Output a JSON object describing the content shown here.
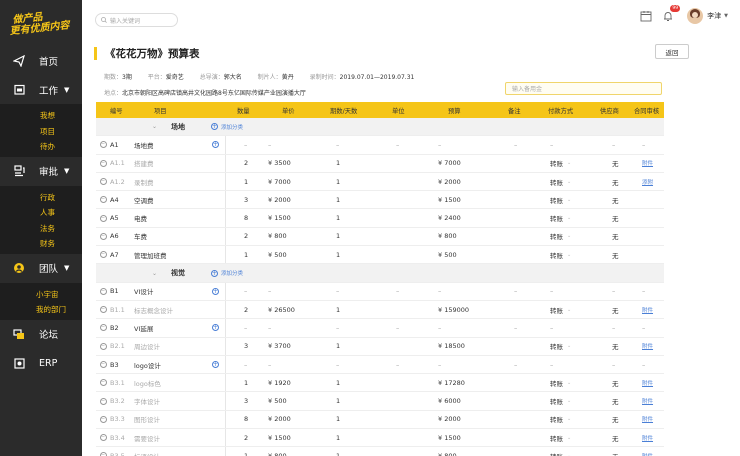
{
  "sidebar": {
    "logo_line1": "做产品",
    "logo_line2": "更有优质内容",
    "nav": {
      "home": "首页",
      "work": "工作",
      "work_sub": [
        "我想",
        "项目",
        "待办"
      ],
      "approval": "审批",
      "approval_sub": [
        "行政",
        "人事",
        "法务",
        "财务"
      ],
      "team": "团队",
      "team_sub": [
        "小宇宙",
        "我的部门"
      ],
      "forum": "论坛",
      "erp": "ERP"
    }
  },
  "topbar": {
    "search_placeholder": "输入关键词",
    "badge_count": "99",
    "user_name": "李津"
  },
  "page": {
    "title": "《花花万物》预算表",
    "return_label": "返回",
    "meta": {
      "episode_label": "期数：",
      "episode_value": "3期",
      "platform_label": "平台：",
      "platform_value": "爱奇艺",
      "director_label": "总导演：",
      "director_value": "郭大名",
      "producer_label": "制片人：",
      "producer_value": "黄丹",
      "period_label": "录制时间：",
      "period_value": "2019.07.01—2019.07.31",
      "location_label": "地点：",
      "location_value": "北京市朝阳区高碑店镇高井文化园路8号东亿国际传媒产业园演播大厅"
    },
    "note_placeholder": "输入备用金"
  },
  "table": {
    "headers": [
      "编号",
      "项目",
      "数量",
      "单价",
      "期数/天数",
      "单位",
      "预算",
      "备注",
      "付款方式",
      "供应商",
      "合同审核"
    ],
    "add_category": "添加分类",
    "groups": [
      {
        "name": "场地",
        "rows": [
          {
            "code": "A1",
            "item": "场地费",
            "qty": "–",
            "price": "–",
            "days": "–",
            "unit": "–",
            "budget": "–",
            "remark": "–",
            "pay": "–",
            "sup": "–",
            "contract": "–",
            "type": "main"
          },
          {
            "code": "A1.1",
            "item": "搭建费",
            "qty": "2",
            "price": "¥  3500",
            "days": "1",
            "unit": "",
            "budget": "¥  7000",
            "remark": "",
            "pay": "转账",
            "sup": "无",
            "contract": "附件",
            "type": "sub"
          },
          {
            "code": "A1.2",
            "item": "录制费",
            "qty": "1",
            "price": "¥  7000",
            "days": "1",
            "unit": "",
            "budget": "¥  2000",
            "remark": "",
            "pay": "转账",
            "sup": "无",
            "contract": "添附",
            "type": "sub"
          },
          {
            "code": "A4",
            "item": "空调费",
            "qty": "3",
            "price": "¥  2000",
            "days": "1",
            "unit": "",
            "budget": "¥  1500",
            "remark": "",
            "pay": "转账",
            "sup": "无",
            "contract": "",
            "type": "main"
          },
          {
            "code": "A5",
            "item": "电费",
            "qty": "8",
            "price": "¥  1500",
            "days": "1",
            "unit": "",
            "budget": "¥  2400",
            "remark": "",
            "pay": "转账",
            "sup": "无",
            "contract": "",
            "type": "main"
          },
          {
            "code": "A6",
            "item": "车费",
            "qty": "2",
            "price": "¥  800",
            "days": "1",
            "unit": "",
            "budget": "¥  800",
            "remark": "",
            "pay": "转账",
            "sup": "无",
            "contract": "",
            "type": "main"
          },
          {
            "code": "A7",
            "item": "管理加班费",
            "qty": "1",
            "price": "¥  500",
            "days": "1",
            "unit": "",
            "budget": "¥  500",
            "remark": "",
            "pay": "转账",
            "sup": "无",
            "contract": "",
            "type": "main"
          }
        ]
      },
      {
        "name": "视觉",
        "rows": [
          {
            "code": "B1",
            "item": "VI设计",
            "qty": "–",
            "price": "–",
            "days": "–",
            "unit": "–",
            "budget": "–",
            "remark": "–",
            "pay": "–",
            "sup": "–",
            "contract": "–",
            "type": "main"
          },
          {
            "code": "B1.1",
            "item": "标志概念设计",
            "qty": "2",
            "price": "¥  26500",
            "days": "1",
            "unit": "",
            "budget": "¥  159000",
            "remark": "",
            "pay": "转账",
            "sup": "无",
            "contract": "附件",
            "type": "sub"
          },
          {
            "code": "B2",
            "item": "VI延展",
            "qty": "–",
            "price": "–",
            "days": "–",
            "unit": "–",
            "budget": "–",
            "remark": "–",
            "pay": "–",
            "sup": "–",
            "contract": "–",
            "type": "main"
          },
          {
            "code": "B2.1",
            "item": "周边设计",
            "qty": "3",
            "price": "¥  3700",
            "days": "1",
            "unit": "",
            "budget": "¥  18500",
            "remark": "",
            "pay": "转账",
            "sup": "无",
            "contract": "附件",
            "type": "sub"
          },
          {
            "code": "B3",
            "item": "logo设计",
            "qty": "–",
            "price": "–",
            "days": "–",
            "unit": "–",
            "budget": "–",
            "remark": "–",
            "pay": "–",
            "sup": "–",
            "contract": "–",
            "type": "main"
          },
          {
            "code": "B3.1",
            "item": "logo标色",
            "qty": "1",
            "price": "¥  1920",
            "days": "1",
            "unit": "",
            "budget": "¥  17280",
            "remark": "",
            "pay": "转账",
            "sup": "无",
            "contract": "附件",
            "type": "sub"
          },
          {
            "code": "B3.2",
            "item": "字体设计",
            "qty": "3",
            "price": "¥  500",
            "days": "1",
            "unit": "",
            "budget": "¥  6000",
            "remark": "",
            "pay": "转账",
            "sup": "无",
            "contract": "附件",
            "type": "sub"
          },
          {
            "code": "B3.3",
            "item": "图形设计",
            "qty": "8",
            "price": "¥  2000",
            "days": "1",
            "unit": "",
            "budget": "¥  2000",
            "remark": "",
            "pay": "转账",
            "sup": "无",
            "contract": "附件",
            "type": "sub"
          },
          {
            "code": "B3.4",
            "item": "需要设计",
            "qty": "2",
            "price": "¥  1500",
            "days": "1",
            "unit": "",
            "budget": "¥  1500",
            "remark": "",
            "pay": "转账",
            "sup": "无",
            "contract": "附件",
            "type": "sub"
          },
          {
            "code": "B3.5",
            "item": "标语设计",
            "qty": "1",
            "price": "¥  800",
            "days": "1",
            "unit": "",
            "budget": "¥  800",
            "remark": "",
            "pay": "转账",
            "sup": "无",
            "contract": "附件",
            "type": "sub"
          }
        ]
      }
    ]
  },
  "colors": {
    "accent": "#f5c518",
    "sidebar": "#2b2b2b",
    "link": "#4a7fd6"
  }
}
